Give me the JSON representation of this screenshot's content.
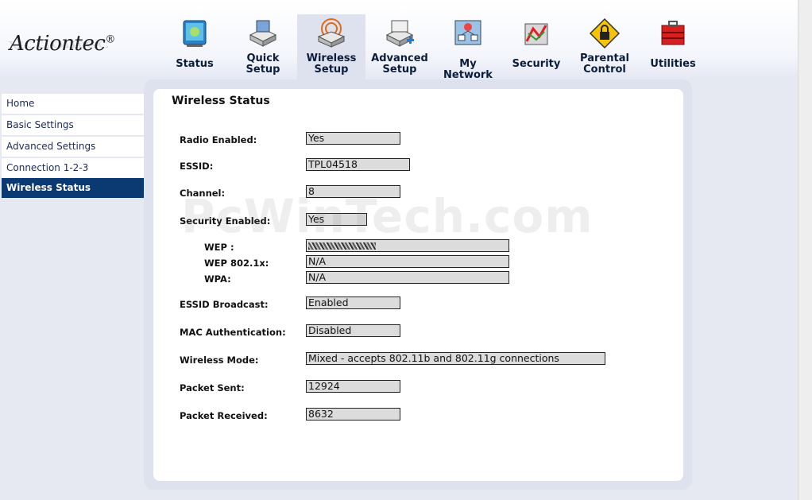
{
  "brand": {
    "logo_text": "Actiontec",
    "registered": "®"
  },
  "nav": {
    "status": "Status",
    "quick_setup": "Quick Setup",
    "wireless_setup": "Wireless Setup",
    "advanced_setup": "Advanced Setup",
    "my_network": "My Network",
    "security": "Security",
    "parental_control": "Parental Control",
    "utilities": "Utilities"
  },
  "sidebar": {
    "items": [
      "Home",
      "Basic Settings",
      "Advanced Settings",
      "Connection 1-2-3",
      "Wireless Status"
    ],
    "active_index": 4
  },
  "page": {
    "title": "Wireless Status",
    "watermark": "PcWinTech.com"
  },
  "fields": {
    "radio_enabled": {
      "label": "Radio Enabled:",
      "value": "Yes"
    },
    "essid": {
      "label": "ESSID:",
      "value": "TPL04518"
    },
    "channel": {
      "label": "Channel:",
      "value": "8"
    },
    "security_enabled": {
      "label": "Security Enabled:",
      "value": "Yes"
    },
    "wep": {
      "label": "WEP :",
      "value": ""
    },
    "wep_8021x": {
      "label": "WEP 802.1x:",
      "value": "N/A"
    },
    "wpa": {
      "label": "WPA:",
      "value": "N/A"
    },
    "essid_broadcast": {
      "label": "ESSID Broadcast:",
      "value": "Enabled"
    },
    "mac_auth": {
      "label": "MAC Authentication:",
      "value": "Disabled"
    },
    "wireless_mode": {
      "label": "Wireless Mode:",
      "value": "Mixed - accepts 802.11b and 802.11g connections"
    },
    "packet_sent": {
      "label": "Packet Sent:",
      "value": "12924"
    },
    "packet_received": {
      "label": "Packet Received:",
      "value": "8632"
    }
  },
  "colors": {
    "sidebar_active_bg": "#0b3a73",
    "panel_bg": "#dde2ee",
    "field_bg": "#dcdcdc"
  }
}
